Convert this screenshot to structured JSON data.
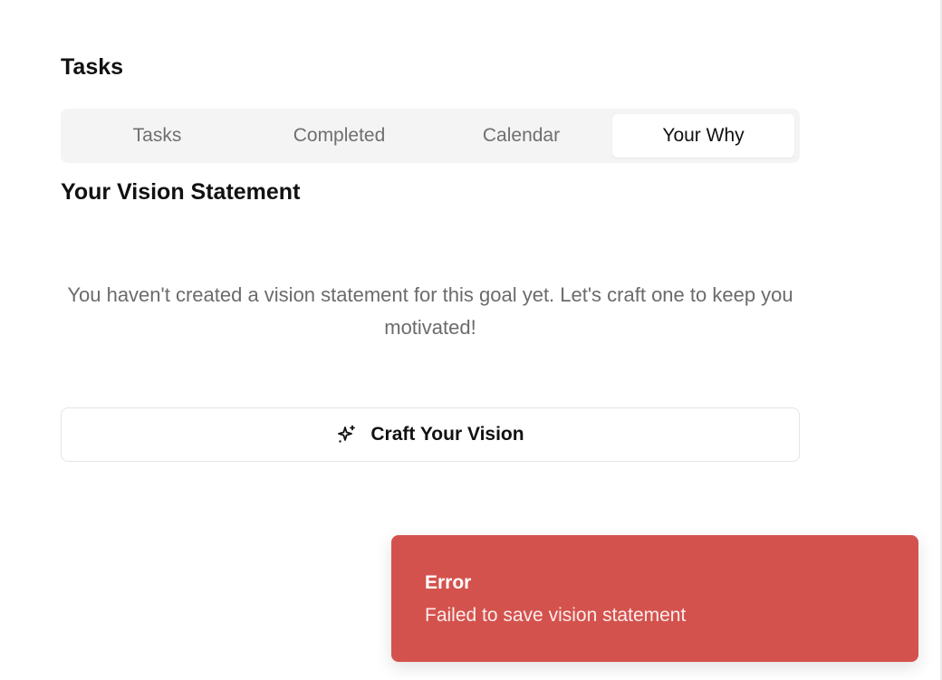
{
  "header": {
    "section_title": "Tasks"
  },
  "tabs": [
    {
      "label": "Tasks",
      "active": false
    },
    {
      "label": "Completed",
      "active": false
    },
    {
      "label": "Calendar",
      "active": false
    },
    {
      "label": "Your Why",
      "active": true
    }
  ],
  "vision": {
    "title": "Your Vision Statement",
    "empty_message": "You haven't created a vision statement for this goal yet. Let's craft one to keep you motivated!",
    "craft_button_label": "Craft Your Vision",
    "craft_button_icon": "sparkles-icon"
  },
  "toast": {
    "title": "Error",
    "message": "Failed to save vision statement",
    "color": "#d4524d"
  }
}
